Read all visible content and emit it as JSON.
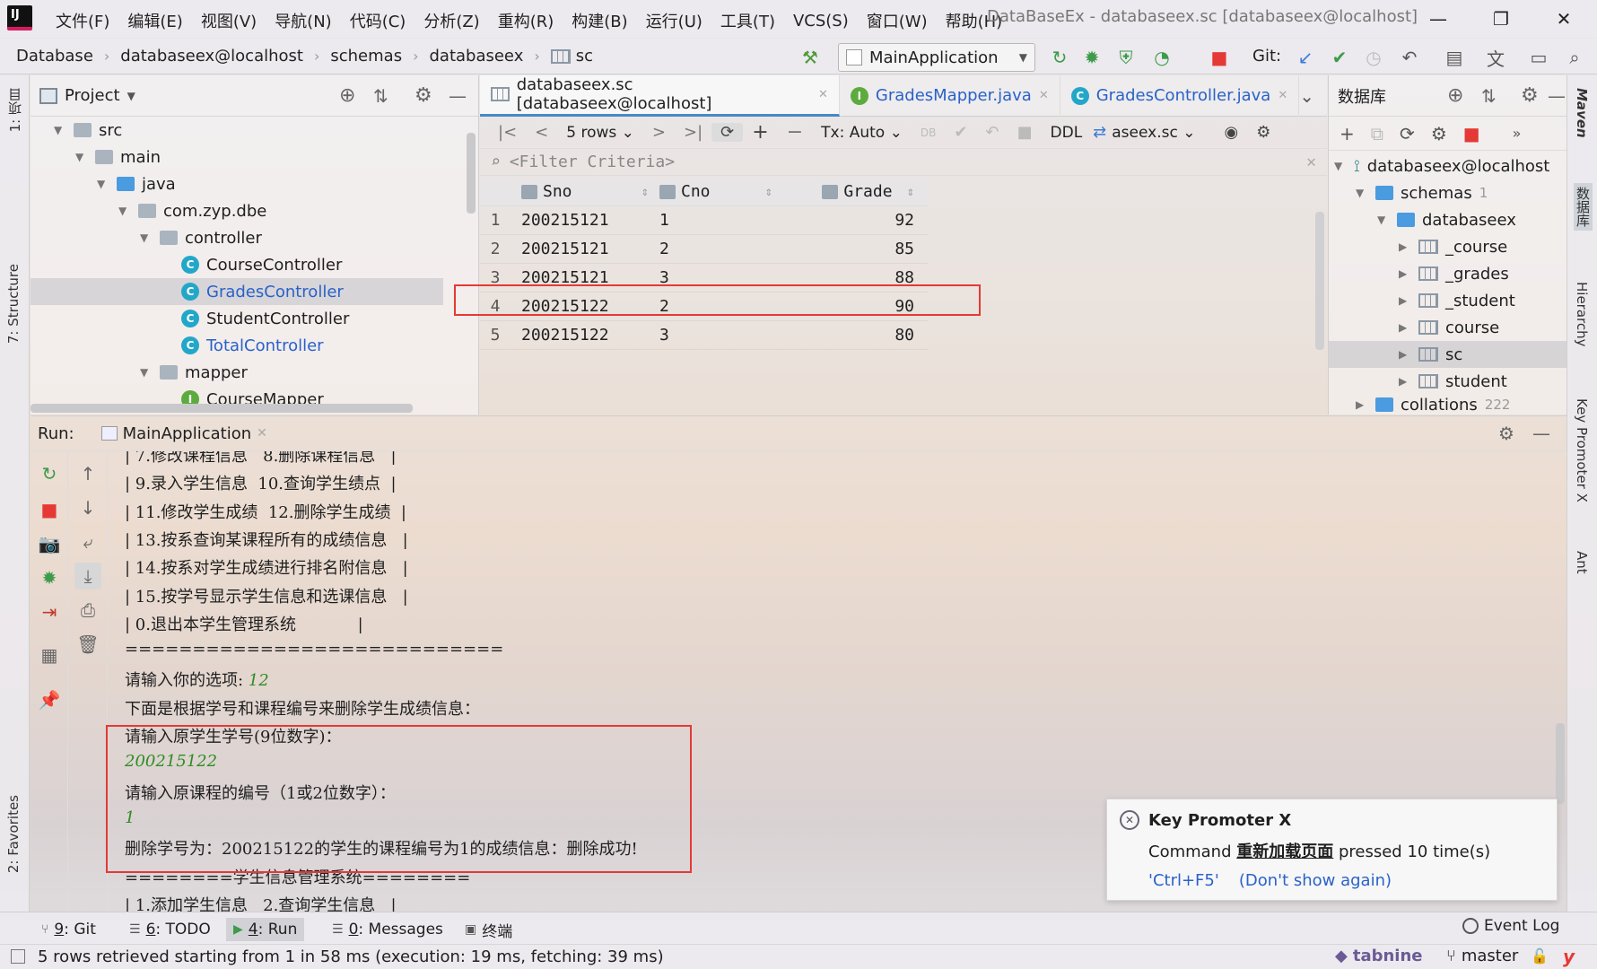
{
  "title_bar": {
    "menus": [
      "文件(F)",
      "编辑(E)",
      "视图(V)",
      "导航(N)",
      "代码(C)",
      "分析(Z)",
      "重构(R)",
      "构建(B)",
      "运行(U)",
      "工具(T)",
      "VCS(S)",
      "窗口(W)",
      "帮助(H)"
    ],
    "window_title": "DataBaseEx - databaseex.sc [databaseex@localhost]"
  },
  "breadcrumb": [
    "Database",
    "databaseex@localhost",
    "schemas",
    "databaseex",
    "sc"
  ],
  "toolbar": {
    "run_config": "MainApplication",
    "git_label": "Git:"
  },
  "left_strip": {
    "project_tab": "1: 项目",
    "structure_tab": "7: Structure",
    "favorites_tab": "2: Favorites"
  },
  "right_strip": {
    "maven_tab": "Maven",
    "db_tab": "数据库",
    "hierarchy_tab": "Hierarchy",
    "kpx_tab": "Key Promoter X",
    "ant_tab": "Ant"
  },
  "project": {
    "title": "Project",
    "tree": [
      {
        "label": "src",
        "kind": "folder",
        "level": 0,
        "expanded": true
      },
      {
        "label": "main",
        "kind": "folder",
        "level": 1,
        "expanded": true
      },
      {
        "label": "java",
        "kind": "folder-blue",
        "level": 2,
        "expanded": true
      },
      {
        "label": "com.zyp.dbe",
        "kind": "package",
        "level": 3,
        "expanded": true
      },
      {
        "label": "controller",
        "kind": "package",
        "level": 4,
        "expanded": true
      },
      {
        "label": "CourseController",
        "kind": "class",
        "level": 5
      },
      {
        "label": "GradesController",
        "kind": "class",
        "level": 5,
        "selected": true,
        "color": "#2a62c8"
      },
      {
        "label": "StudentController",
        "kind": "class",
        "level": 5
      },
      {
        "label": "TotalController",
        "kind": "class",
        "level": 5,
        "color": "#2a62c8"
      },
      {
        "label": "mapper",
        "kind": "package",
        "level": 4,
        "expanded": true
      },
      {
        "label": "CourseMapper",
        "kind": "interface",
        "level": 5
      }
    ]
  },
  "editor": {
    "tabs": [
      {
        "label": "databaseex.sc [databaseex@localhost]",
        "icon": "table-icon",
        "active": true
      },
      {
        "label": "GradesMapper.java",
        "icon": "interface-icon",
        "color": "#2a62c8"
      },
      {
        "label": "GradesController.java",
        "icon": "class-icon",
        "color": "#2a62c8"
      }
    ],
    "grid_toolbar": {
      "rows": "5 rows",
      "tx": "Tx: Auto",
      "ddl": "DDL",
      "schema": "aseex.sc"
    },
    "filter_placeholder": "<Filter Criteria>",
    "columns": [
      "Sno",
      "Cno",
      "Grade"
    ],
    "rows": [
      {
        "n": "1",
        "sno": "200215121",
        "cno": "1",
        "grade": "92"
      },
      {
        "n": "2",
        "sno": "200215121",
        "cno": "2",
        "grade": "85"
      },
      {
        "n": "3",
        "sno": "200215121",
        "cno": "3",
        "grade": "88"
      },
      {
        "n": "4",
        "sno": "200215122",
        "cno": "2",
        "grade": "90"
      },
      {
        "n": "5",
        "sno": "200215122",
        "cno": "3",
        "grade": "80"
      }
    ]
  },
  "db_panel": {
    "title": "数据库",
    "connection": "databaseex@localhost",
    "schemas": "schemas",
    "schemas_count": "1",
    "db": "databaseex",
    "tables": [
      "_course",
      "_grades",
      "_student",
      "course",
      "sc",
      "student"
    ],
    "collations": "collations",
    "collations_count": "222"
  },
  "run": {
    "label": "Run:",
    "tab": "MainApplication",
    "lines": [
      {
        "t": "| 7.修改课程信息   8.删除课程信息   |",
        "in": false
      },
      {
        "t": "| 9.录入学生信息  10.查询学生绩点  |",
        "in": false
      },
      {
        "t": "| 11.修改学生成绩  12.删除学生成绩  |",
        "in": false
      },
      {
        "t": "| 13.按系查询某课程所有的成绩信息   |",
        "in": false
      },
      {
        "t": "| 14.按系对学生成绩进行排名附信息   |",
        "in": false
      },
      {
        "t": "| 15.按学号显示学生信息和选课信息   |",
        "in": false
      },
      {
        "t": "| 0.退出本学生管理系统            |",
        "in": false
      },
      {
        "t": "============================",
        "in": false
      },
      {
        "t": "请输入你的选项: ",
        "in": false,
        "suffix": "12"
      },
      {
        "t": "下面是根据学号和课程编号来删除学生成绩信息：",
        "in": false
      },
      {
        "t": "请输入原学生学号(9位数字)：",
        "in": false
      },
      {
        "t": "200215122",
        "in": true
      },
      {
        "t": "请输入原课程的编号（1或2位数字）：",
        "in": false
      },
      {
        "t": "1",
        "in": true
      },
      {
        "t": "删除学号为：200215122的学生的课程编号为1的成绩信息：删除成功!",
        "in": false
      },
      {
        "t": "========学生信息管理系统========",
        "in": false
      },
      {
        "t": "| 1.添加学生信息   2.查询学生信息   |",
        "in": false
      }
    ]
  },
  "popup": {
    "title": "Key Promoter X",
    "prefix": "Command ",
    "command": "重新加载页面",
    "suffix": " pressed 10 time(s)",
    "shortcut": "'Ctrl+F5'",
    "dont_show": "(Don't show again)"
  },
  "tool_windows": [
    {
      "num": "9",
      "label": ": Git"
    },
    {
      "num": "6",
      "label": ": TODO"
    },
    {
      "num": "4",
      "label": ": Run",
      "active": true
    },
    {
      "num": "0",
      "label": ": Messages"
    },
    {
      "num": "",
      "label": "终端"
    }
  ],
  "event_log": "Event Log",
  "status": {
    "message": "5 rows retrieved starting from 1 in 58 ms (execution: 19 ms, fetching: 39 ms)",
    "tabnine": "tabnine",
    "branch": "master"
  },
  "colors": {
    "accent": "#4a88c7",
    "highlight": "#e53935",
    "green": "#2e8b22",
    "link": "#2a62c8"
  }
}
